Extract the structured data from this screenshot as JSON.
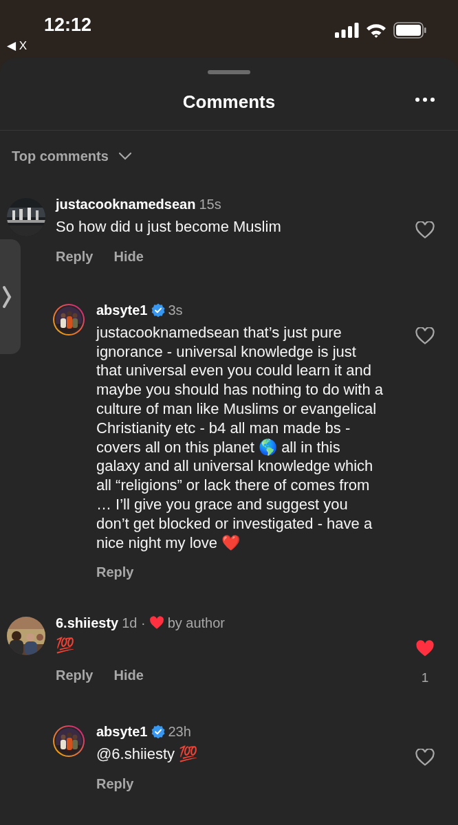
{
  "status_bar": {
    "time": "12:12",
    "back_label": "◀ X"
  },
  "sheet": {
    "title": "Comments",
    "sort": {
      "label": "Top comments"
    }
  },
  "comments": [
    {
      "username": "justacooknamedsean",
      "verified": false,
      "time": "15s",
      "liked_by_author": false,
      "text": "So how did u just become Muslim",
      "actions": [
        "Reply",
        "Hide"
      ],
      "liked": false,
      "replies": [
        {
          "username": "absyte1",
          "verified": true,
          "time": "3s",
          "liked_by_author": false,
          "text": "justacooknamedsean that’s just pure ignorance - universal knowledge is just that universal even you could learn it and maybe you should has nothing to do with a culture of man like Muslims or evangelical Christianity etc - b4 all man made bs - covers all on this planet 🌎 all in this galaxy and all universal knowledge which all “religions” or lack there of comes from … I’ll give you grace and suggest you don’t get blocked or investigated - have a nice night my love ❤️",
          "actions": [
            "Reply"
          ],
          "liked": false
        }
      ]
    },
    {
      "username": "6.shiiesty",
      "verified": false,
      "time": "1d ·",
      "liked_by_author": true,
      "author_like_label": "by author",
      "text": "💯",
      "actions": [
        "Reply",
        "Hide"
      ],
      "liked": true,
      "like_count": "1",
      "replies": [
        {
          "username": "absyte1",
          "verified": true,
          "time": "23h",
          "liked_by_author": false,
          "text": "@6.shiiesty 💯",
          "actions": [
            "Reply"
          ],
          "liked": false
        }
      ]
    }
  ]
}
